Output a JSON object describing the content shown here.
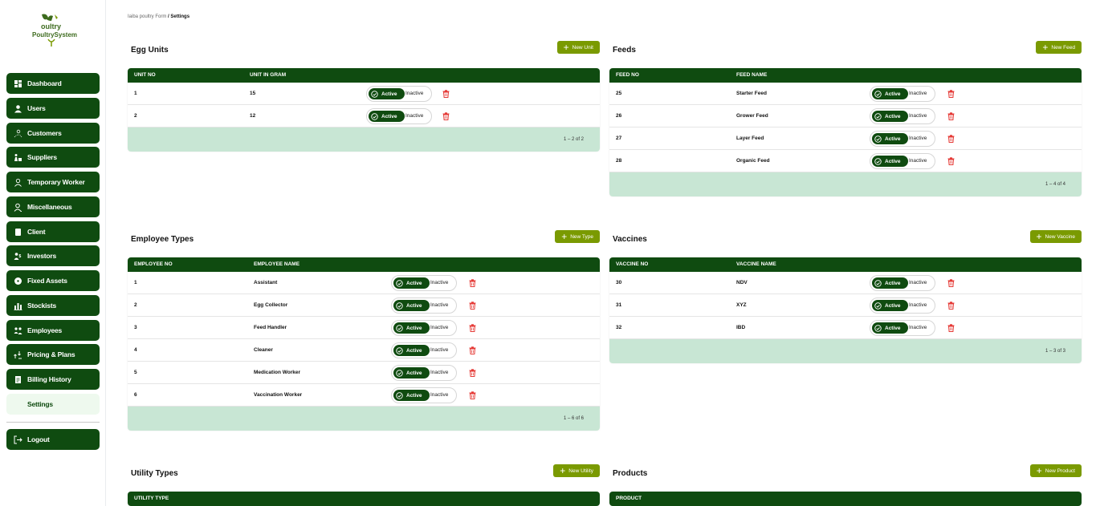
{
  "brand": {
    "logo_text": "oultry PoultrySystem"
  },
  "sidebar": {
    "items": [
      {
        "label": "Dashboard",
        "icon": "dashboard-icon"
      },
      {
        "label": "Users",
        "icon": "user-icon"
      },
      {
        "label": "Customers",
        "icon": "customers-icon"
      },
      {
        "label": "Suppliers",
        "icon": "suppliers-icon"
      },
      {
        "label": "Temporary Worker",
        "icon": "worker-icon"
      },
      {
        "label": "Miscellaneous",
        "icon": "misc-icon"
      },
      {
        "label": "Client",
        "icon": "client-icon"
      },
      {
        "label": "Investors",
        "icon": "investors-icon"
      },
      {
        "label": "Fixed Assets",
        "icon": "assets-icon"
      },
      {
        "label": "Stockists",
        "icon": "stockists-icon"
      },
      {
        "label": "Employees",
        "icon": "employees-icon"
      },
      {
        "label": "Pricing & Plans",
        "icon": "pricing-icon"
      },
      {
        "label": "Billing History",
        "icon": "billing-icon"
      },
      {
        "label": "Settings",
        "icon": "settings-icon"
      }
    ],
    "logout_label": "Logout"
  },
  "breadcrumb": {
    "parent": "Iaiba poultry Form",
    "sep": " / ",
    "current": "Settings"
  },
  "toggle": {
    "active": "Active",
    "inactive": "Inactive"
  },
  "colors": {
    "primary": "#0f4b10",
    "accent": "#7a9a01",
    "footer": "#c8e6d4",
    "danger": "#e53935"
  },
  "sections": {
    "egg_units": {
      "title": "Egg Units",
      "button": "New Unit",
      "columns": [
        "UNIT NO",
        "UNIT IN GRAM"
      ],
      "rows": [
        [
          "1",
          "15"
        ],
        [
          "2",
          "12"
        ]
      ],
      "pagination": "1 – 2 of 2"
    },
    "feeds": {
      "title": "Feeds",
      "button": "New Feed",
      "columns": [
        "FEED NO",
        "FEED NAME"
      ],
      "rows": [
        [
          "25",
          "Starter Feed"
        ],
        [
          "26",
          "Grower Feed"
        ],
        [
          "27",
          "Layer Feed"
        ],
        [
          "28",
          "Organic Feed"
        ]
      ],
      "pagination": "1 – 4 of 4"
    },
    "employee_types": {
      "title": "Employee Types",
      "button": "New Type",
      "columns": [
        "EMPLOYEE NO",
        "EMPLOYEE NAME"
      ],
      "rows": [
        [
          "1",
          "Assistant"
        ],
        [
          "2",
          "Egg Collector"
        ],
        [
          "3",
          "Feed Handler"
        ],
        [
          "4",
          "Cleaner"
        ],
        [
          "5",
          "Medication Worker"
        ],
        [
          "6",
          "Vaccination Worker"
        ]
      ],
      "pagination": "1 – 6 of 6"
    },
    "vaccines": {
      "title": "Vaccines",
      "button": "New Vaccine",
      "columns": [
        "VACCINE NO",
        "VACCINE NAME"
      ],
      "rows": [
        [
          "30",
          "NDV"
        ],
        [
          "31",
          "XYZ"
        ],
        [
          "32",
          "IBD"
        ]
      ],
      "pagination": "1 – 3 of 3"
    },
    "utility_types": {
      "title": "Utility Types",
      "button": "New Utility",
      "columns": [
        "UTILITY TYPE"
      ],
      "rows": [],
      "pagination": ""
    },
    "products": {
      "title": "Products",
      "button": "New Product",
      "columns": [
        "PRODUCT"
      ],
      "rows": [],
      "pagination": ""
    }
  }
}
